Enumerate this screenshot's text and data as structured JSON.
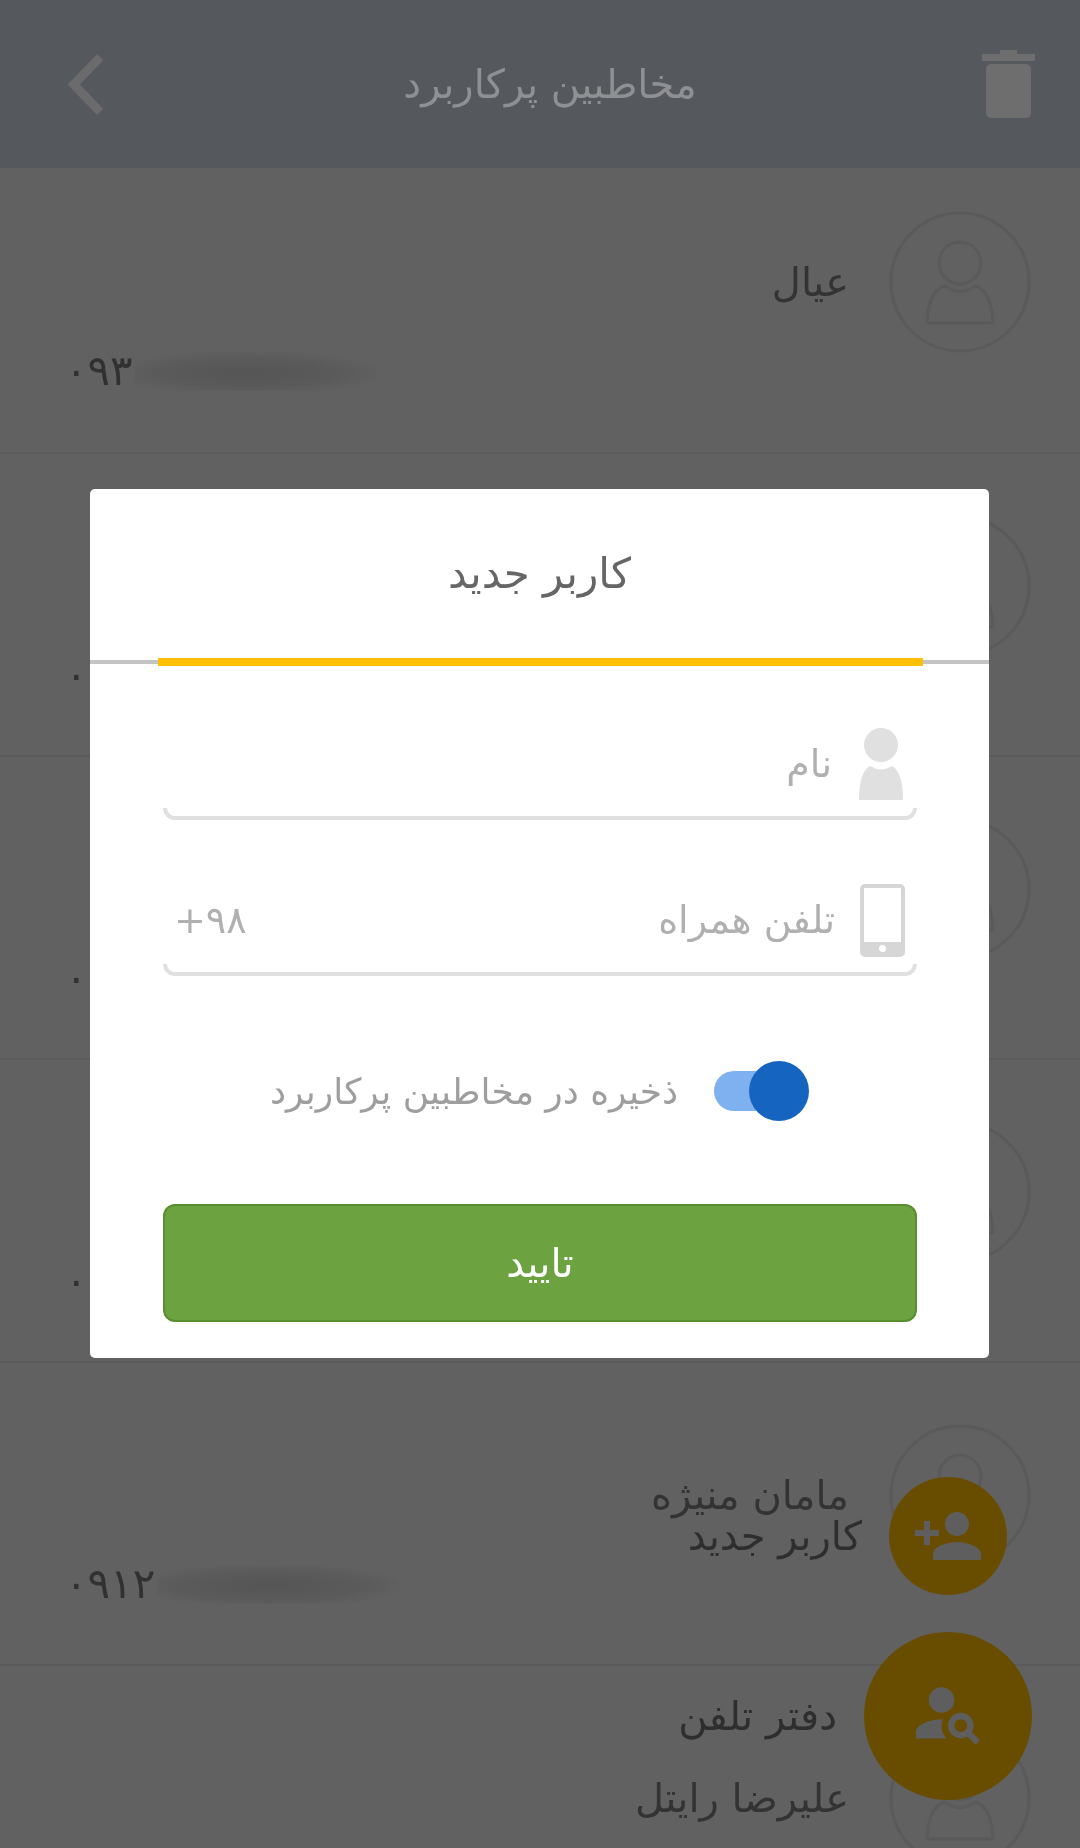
{
  "app_bar": {
    "title": "مخاطبین پرکاربرد"
  },
  "contacts": [
    {
      "name": "عیال",
      "phone": "۰۹۳",
      "redacted": true
    },
    {
      "phone": "۰"
    },
    {
      "phone": "۰"
    },
    {
      "phone": "۰"
    },
    {
      "name": "مامان منیژه",
      "phone": "۰۹۱۲",
      "redacted": true
    },
    {
      "name": "علیرضا رایتل"
    }
  ],
  "dialog": {
    "title": "کاربر جدید",
    "fields": [
      {
        "kind": "name",
        "placeholder": "نام"
      },
      {
        "kind": "phone",
        "placeholder": "تلفن همراه",
        "prefix": "+۹۸"
      }
    ],
    "switch": {
      "label": "ذخیره در مخاطبین پرکاربرد",
      "on": true
    },
    "confirm_button": "تایید"
  },
  "fab_menu": [
    {
      "kind": "add-user",
      "label": "کاربر جدید"
    },
    {
      "kind": "phonebook",
      "label": "دفتر تلفن"
    }
  ]
}
